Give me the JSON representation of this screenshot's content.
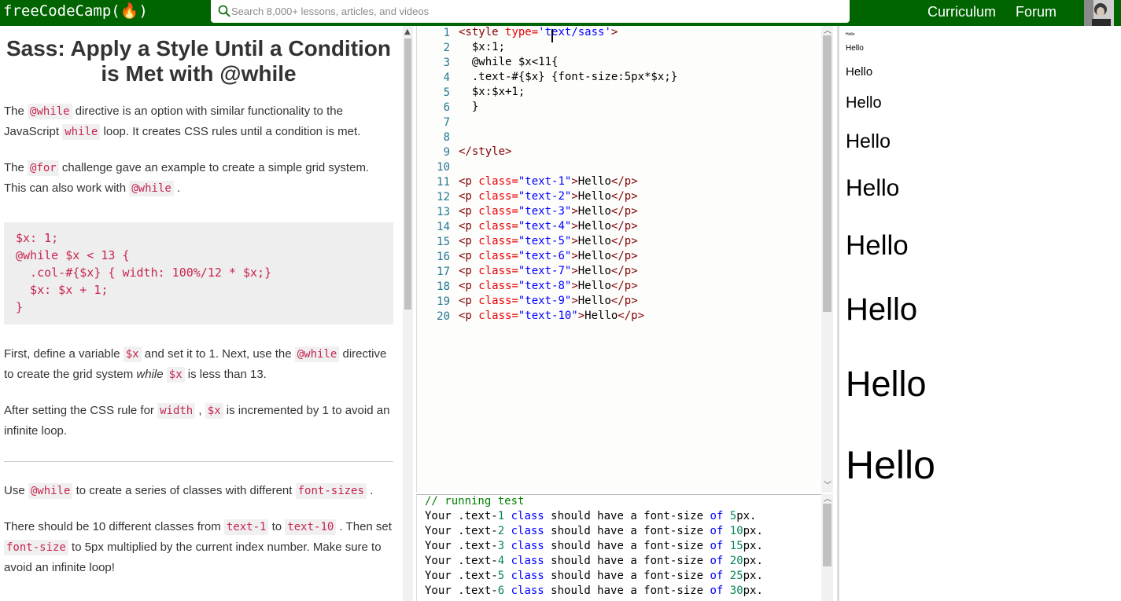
{
  "nav": {
    "brand": "freeCodeCamp(🔥)",
    "search_placeholder": "Search 8,000+ lessons, articles, and videos",
    "links": [
      "Curriculum",
      "Forum"
    ]
  },
  "lesson": {
    "title": "Sass: Apply a Style Until a Condition is Met with @while",
    "p1": {
      "a": "The ",
      "c1": "@while",
      "b": " directive is an option with similar functionality to the JavaScript ",
      "c2": "while",
      "d": " loop. It creates CSS rules until a condition is met."
    },
    "p2": {
      "a": "The ",
      "c1": "@for",
      "b": " challenge gave an example to create a simple grid system. This can also work with ",
      "c2": "@while",
      "d": " ."
    },
    "code_example": "$x: 1;\n@while $x < 13 {\n  .col-#{$x} { width: 100%/12 * $x;}\n  $x: $x + 1;\n}",
    "p3": {
      "a": "First, define a variable ",
      "c1": "$x",
      "b": " and set it to 1. Next, use the ",
      "c2": "@while",
      "d": " directive to create the grid system ",
      "em": "while",
      "c3": "$x",
      "e": " is less than 13."
    },
    "p4": {
      "a": "After setting the CSS rule for ",
      "c1": "width",
      "b": " , ",
      "c2": "$x",
      "d": " is incremented by 1 to avoid an infinite loop."
    },
    "p5": {
      "a": "Use ",
      "c1": "@while",
      "b": " to create a series of classes with different ",
      "c2": "font-sizes",
      "d": " ."
    },
    "p6": {
      "a": "There should be 10 different classes from ",
      "c1": "text-1",
      "b": " to ",
      "c2": "text-10",
      "d": " . Then set ",
      "c3": "font-size",
      "e": " to 5px multiplied by the current index number. Make sure to avoid an infinite loop!"
    }
  },
  "editor": {
    "line_numbers": [
      "1",
      "2",
      "3",
      "4",
      "5",
      "6",
      "7",
      "8",
      "9",
      "10",
      "11",
      "12",
      "13",
      "14",
      "15",
      "16",
      "17",
      "18",
      "19",
      "20"
    ],
    "sass_lines": [
      "  $x:1;",
      "  @while $x<11{",
      "  .text-#{$x} {font-size:5px*$x;}",
      "  $x:$x+1;",
      "  }"
    ],
    "style_open": {
      "tag_open": "<style ",
      "attr": "type=",
      "val": "'text/sass'",
      "tag_close": ">"
    },
    "style_close": "</style>",
    "p_lines": [
      {
        "cls": "\"text-1\"",
        "text": "Hello"
      },
      {
        "cls": "\"text-2\"",
        "text": "Hello"
      },
      {
        "cls": "\"text-3\"",
        "text": "Hello"
      },
      {
        "cls": "\"text-4\"",
        "text": "Hello"
      },
      {
        "cls": "\"text-5\"",
        "text": "Hello"
      },
      {
        "cls": "\"text-6\"",
        "text": "Hello"
      },
      {
        "cls": "\"text-7\"",
        "text": "Hello"
      },
      {
        "cls": "\"text-8\"",
        "text": "Hello"
      },
      {
        "cls": "\"text-9\"",
        "text": "Hello"
      },
      {
        "cls": "\"text-10\"",
        "text": "Hello"
      }
    ]
  },
  "console": {
    "header": "// running test",
    "tests": [
      {
        "n": "1",
        "px": "5"
      },
      {
        "n": "2",
        "px": "10"
      },
      {
        "n": "3",
        "px": "15"
      },
      {
        "n": "4",
        "px": "20"
      },
      {
        "n": "5",
        "px": "25"
      },
      {
        "n": "6",
        "px": "30"
      }
    ]
  },
  "preview": {
    "items": [
      "Hello",
      "Hello",
      "Hello",
      "Hello",
      "Hello",
      "Hello",
      "Hello",
      "Hello",
      "Hello"
    ]
  }
}
